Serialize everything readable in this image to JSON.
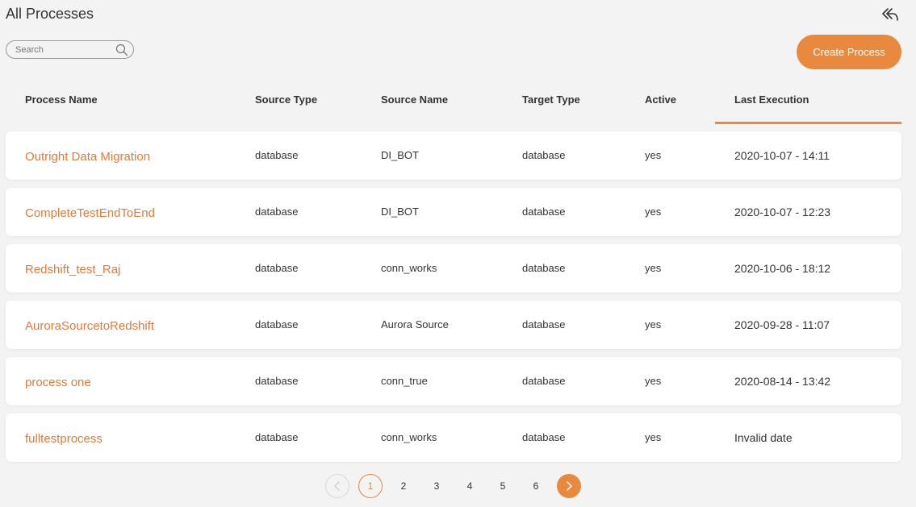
{
  "page": {
    "title": "All Processes",
    "back_icon": "reply-back-icon",
    "accent_color": "#e8893e"
  },
  "search": {
    "placeholder": "Search",
    "icon": "search-icon"
  },
  "create_button": {
    "label": "Create Process"
  },
  "table": {
    "columns": [
      "Process Name",
      "Source Type",
      "Source Name",
      "Target Type",
      "Active",
      "Last Execution"
    ],
    "sorted_column": "Last Execution",
    "rows": [
      {
        "name": "Outright Data Migration",
        "source_type": "database",
        "source_name": "DI_BOT",
        "target_type": "database",
        "active": "yes",
        "last_execution": "2020-10-07 - 14:11"
      },
      {
        "name": "CompleteTestEndToEnd",
        "source_type": "database",
        "source_name": "DI_BOT",
        "target_type": "database",
        "active": "yes",
        "last_execution": "2020-10-07 - 12:23"
      },
      {
        "name": "Redshift_test_Raj",
        "source_type": "database",
        "source_name": "conn_works",
        "target_type": "database",
        "active": "yes",
        "last_execution": "2020-10-06 - 18:12"
      },
      {
        "name": "AuroraSourcetoRedshift",
        "source_type": "database",
        "source_name": "Aurora Source",
        "target_type": "database",
        "active": "yes",
        "last_execution": "2020-09-28 - 11:07"
      },
      {
        "name": "process one",
        "source_type": "database",
        "source_name": "conn_true",
        "target_type": "database",
        "active": "yes",
        "last_execution": "2020-08-14 - 13:42"
      },
      {
        "name": "fulltestprocess",
        "source_type": "database",
        "source_name": "conn_works",
        "target_type": "database",
        "active": "yes",
        "last_execution": "Invalid date"
      }
    ]
  },
  "pagination": {
    "prev_icon": "chevron-left-icon",
    "next_icon": "chevron-right-icon",
    "pages": [
      "1",
      "2",
      "3",
      "4",
      "5",
      "6"
    ],
    "current": "1"
  }
}
